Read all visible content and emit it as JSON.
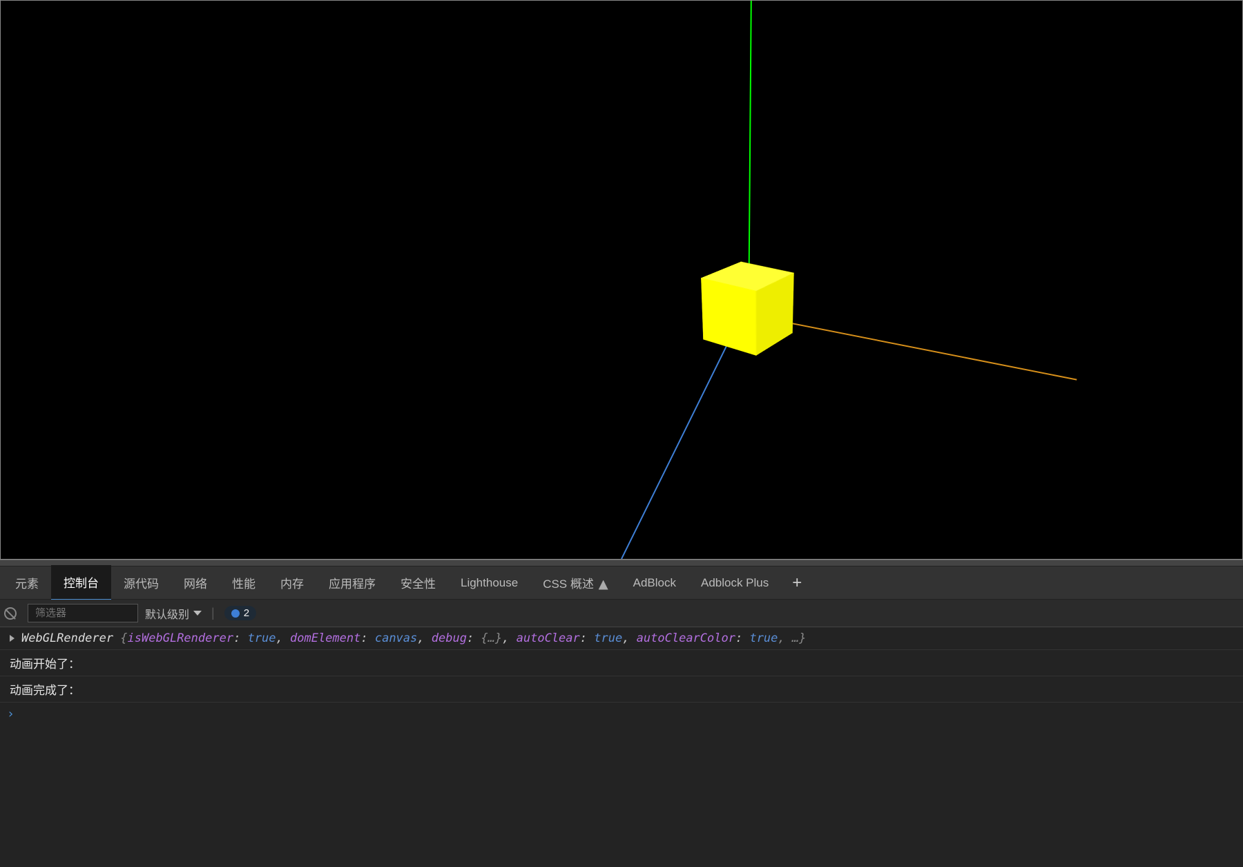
{
  "viewport": {
    "axes": {
      "y_color": "#00ff00",
      "x_color": "#d68f1a",
      "z_color": "#3e7fd6"
    },
    "cube_color": "#ffff00"
  },
  "devtools": {
    "tabs": [
      {
        "label": "元素"
      },
      {
        "label": "控制台"
      },
      {
        "label": "源代码"
      },
      {
        "label": "网络"
      },
      {
        "label": "性能"
      },
      {
        "label": "内存"
      },
      {
        "label": "应用程序"
      },
      {
        "label": "安全性"
      },
      {
        "label": "Lighthouse"
      },
      {
        "label": "CSS 概述"
      },
      {
        "label": "AdBlock"
      },
      {
        "label": "Adblock Plus"
      }
    ],
    "active_tab_index": 1,
    "filter_placeholder": "筛选器",
    "level_label": "默认级别",
    "hidden_count": "2",
    "console_lines": [
      {
        "type": "object",
        "class_name": "WebGLRenderer",
        "props": [
          {
            "k": "isWebGLRenderer",
            "v": "true",
            "vtype": "bool"
          },
          {
            "k": "domElement",
            "v": "canvas",
            "vtype": "val"
          },
          {
            "k": "debug",
            "v": "{…}",
            "vtype": "gray"
          },
          {
            "k": "autoClear",
            "v": "true",
            "vtype": "bool"
          },
          {
            "k": "autoClearColor",
            "v": "true",
            "vtype": "bool"
          }
        ],
        "trailing": ", …"
      },
      {
        "type": "text",
        "text": "动画开始了："
      },
      {
        "type": "text",
        "text": "动画完成了："
      }
    ],
    "prompt": "›"
  }
}
